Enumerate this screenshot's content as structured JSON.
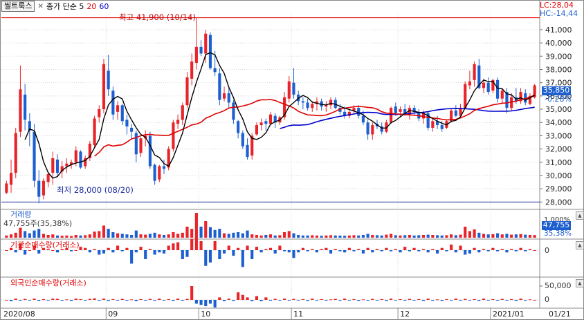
{
  "legend": {
    "prefix": "씰트룩스",
    "ma_label": "종가 단순 5",
    "ma20_label": "20",
    "ma60_label": "60"
  },
  "top_right": {
    "lc": "LC:28,04",
    "hc": "HC:-14,44"
  },
  "annotations": {
    "high": "최고 41,900 (10/14)",
    "low": "최저 28,000 (08/20)"
  },
  "current": {
    "price": "35,850",
    "change": "-0.28%"
  },
  "volume_panel": {
    "title": "거래량",
    "value_text": "47,755주(35,38%)",
    "axis_top": "1,000%",
    "current": "47,755",
    "current_pct": "35,38%"
  },
  "inst_panel": {
    "title": "기관순매수량(거래소)",
    "axis_zero": "0"
  },
  "foreign_panel": {
    "title": "외국인순매수량(거래소)",
    "axis_top": "50,000",
    "axis_zero": "0"
  },
  "colors": {
    "up": "#e8242a",
    "down": "#1e5fd0",
    "ma5": "#000000",
    "ma20": "#e00000",
    "ma60": "#0000cc"
  },
  "chart_data": {
    "type": "candlestick",
    "title": "",
    "y_ticks": [
      "41,000",
      "40,000",
      "39,000",
      "38,000",
      "37,000",
      "36,000",
      "35,000",
      "34,000",
      "33,000",
      "32,000",
      "31,000",
      "30,000",
      "29,000",
      "28,000"
    ],
    "x_ticks": [
      "2020/08",
      "09",
      "10",
      "11",
      "12",
      "2021/01",
      "01/21"
    ],
    "ylim": [
      27600,
      42300
    ],
    "grid": true,
    "high_price": 41900,
    "low_price": 28000,
    "series": [
      {
        "name": "price",
        "ohlc": [
          [
            28700,
            29600,
            28600,
            29400
          ],
          [
            29300,
            31200,
            28700,
            30200
          ],
          [
            30200,
            33600,
            29800,
            33200
          ],
          [
            33300,
            38300,
            32900,
            36500
          ],
          [
            36100,
            36900,
            33400,
            34200
          ],
          [
            34100,
            34700,
            32200,
            33400
          ],
          [
            33300,
            33900,
            29100,
            29600
          ],
          [
            29600,
            30400,
            27900,
            28400
          ],
          [
            28500,
            29800,
            28200,
            29600
          ],
          [
            29500,
            30300,
            29100,
            30100
          ],
          [
            30200,
            31800,
            29300,
            31300
          ],
          [
            31200,
            31600,
            29900,
            30200
          ],
          [
            30300,
            31100,
            29800,
            30700
          ],
          [
            30700,
            31300,
            30200,
            30900
          ],
          [
            30800,
            31200,
            30500,
            31000
          ],
          [
            31000,
            32200,
            30700,
            31900
          ],
          [
            31800,
            31900,
            30500,
            30600
          ],
          [
            30700,
            31500,
            30500,
            31300
          ],
          [
            31300,
            32600,
            31100,
            32400
          ],
          [
            32300,
            34500,
            32100,
            34300
          ],
          [
            34400,
            35300,
            34000,
            35000
          ],
          [
            35000,
            38800,
            34700,
            38400
          ],
          [
            37900,
            39100,
            36000,
            36500
          ],
          [
            36400,
            36700,
            34200,
            34600
          ],
          [
            34800,
            35600,
            34200,
            35300
          ],
          [
            35300,
            35400,
            33800,
            34100
          ],
          [
            34200,
            34600,
            33100,
            33700
          ],
          [
            33600,
            33900,
            32800,
            33300
          ],
          [
            33200,
            33400,
            31000,
            31600
          ],
          [
            31700,
            32900,
            31400,
            32800
          ],
          [
            32800,
            33400,
            32200,
            33000
          ],
          [
            33000,
            33300,
            30500,
            30700
          ],
          [
            30800,
            30900,
            29300,
            29600
          ],
          [
            29700,
            30800,
            29500,
            30700
          ],
          [
            30700,
            31200,
            30100,
            30500
          ],
          [
            30600,
            32200,
            30400,
            32000
          ],
          [
            32000,
            34200,
            31800,
            34000
          ],
          [
            33900,
            34600,
            33500,
            34200
          ],
          [
            34200,
            35500,
            33800,
            35300
          ],
          [
            35300,
            37800,
            35100,
            37400
          ],
          [
            37300,
            39200,
            36800,
            38600
          ],
          [
            38500,
            41900,
            38000,
            39700
          ],
          [
            39700,
            40200,
            39000,
            39200
          ],
          [
            39200,
            41000,
            38500,
            40700
          ],
          [
            40600,
            40800,
            38000,
            38100
          ],
          [
            38100,
            39400,
            37500,
            37800
          ],
          [
            37700,
            38100,
            35300,
            35700
          ],
          [
            35800,
            36700,
            35600,
            36200
          ],
          [
            36200,
            36600,
            35100,
            35500
          ],
          [
            35500,
            35700,
            33900,
            34200
          ],
          [
            34100,
            34200,
            32800,
            33200
          ],
          [
            33200,
            33400,
            32000,
            32200
          ],
          [
            32300,
            32800,
            31200,
            31400
          ],
          [
            31500,
            33200,
            31200,
            33000
          ],
          [
            33100,
            34000,
            33000,
            33800
          ],
          [
            33800,
            34300,
            33400,
            34000
          ],
          [
            34100,
            34300,
            33400,
            33900
          ],
          [
            33900,
            34800,
            33800,
            34600
          ],
          [
            34500,
            34700,
            33600,
            34000
          ],
          [
            34000,
            34500,
            33800,
            34400
          ],
          [
            34400,
            36300,
            34200,
            35900
          ],
          [
            35800,
            37500,
            35500,
            37100
          ],
          [
            37000,
            38100,
            35800,
            36100
          ],
          [
            36100,
            36400,
            35300,
            35600
          ],
          [
            35600,
            35900,
            35000,
            35500
          ],
          [
            35500,
            35800,
            34900,
            35100
          ],
          [
            35100,
            35600,
            34800,
            35400
          ],
          [
            35400,
            35900,
            34900,
            35600
          ],
          [
            35600,
            35800,
            34900,
            35200
          ],
          [
            35200,
            35600,
            34800,
            35300
          ],
          [
            35300,
            35900,
            35000,
            35700
          ],
          [
            35700,
            35900,
            35000,
            35100
          ],
          [
            35100,
            35400,
            34600,
            34800
          ],
          [
            34800,
            35200,
            34300,
            34500
          ],
          [
            34500,
            35000,
            34300,
            34800
          ],
          [
            34900,
            35300,
            34600,
            35100
          ],
          [
            35100,
            35300,
            34300,
            34500
          ],
          [
            34500,
            34900,
            33800,
            34000
          ],
          [
            34000,
            34200,
            32700,
            33100
          ],
          [
            33100,
            34000,
            32700,
            33800
          ],
          [
            33900,
            34200,
            33500,
            33700
          ],
          [
            33700,
            34000,
            33100,
            33300
          ],
          [
            33300,
            34200,
            33200,
            34000
          ],
          [
            34000,
            35200,
            33900,
            35100
          ],
          [
            35200,
            35500,
            34500,
            34700
          ],
          [
            34800,
            35200,
            34400,
            35000
          ],
          [
            35000,
            35400,
            34500,
            34600
          ],
          [
            34600,
            35300,
            34200,
            35100
          ],
          [
            35100,
            35300,
            34600,
            34800
          ],
          [
            34800,
            35000,
            34100,
            34300
          ],
          [
            34300,
            34900,
            33900,
            34700
          ],
          [
            34700,
            34800,
            33400,
            33600
          ],
          [
            33600,
            34300,
            33300,
            34100
          ],
          [
            34100,
            34500,
            33500,
            33800
          ],
          [
            33800,
            34100,
            33300,
            33500
          ],
          [
            33600,
            34200,
            33500,
            34100
          ],
          [
            34100,
            35000,
            34000,
            34900
          ],
          [
            34900,
            35300,
            34400,
            34500
          ],
          [
            34500,
            35400,
            34400,
            35100
          ],
          [
            35100,
            37100,
            35000,
            36900
          ],
          [
            36800,
            37900,
            36500,
            37100
          ],
          [
            37200,
            38600,
            36700,
            38400
          ],
          [
            38300,
            38800,
            36500,
            36600
          ],
          [
            36600,
            37300,
            36200,
            37000
          ],
          [
            37000,
            37400,
            36100,
            36300
          ],
          [
            36400,
            37300,
            36200,
            37200
          ],
          [
            37200,
            37400,
            35500,
            35800
          ],
          [
            35800,
            36600,
            35400,
            36400
          ],
          [
            36300,
            36600,
            34700,
            35100
          ],
          [
            35100,
            36200,
            34900,
            35900
          ],
          [
            35900,
            36600,
            35400,
            35600
          ],
          [
            35600,
            36600,
            35400,
            36300
          ],
          [
            36200,
            36500,
            35300,
            35500
          ],
          [
            35400,
            36200,
            35300,
            36000
          ],
          [
            35900,
            36900,
            35800,
            36800
          ]
        ]
      },
      {
        "name": "volume",
        "values": [
          40,
          60,
          90,
          180,
          120,
          80,
          130,
          160,
          70,
          50,
          60,
          40,
          35,
          40,
          30,
          50,
          40,
          45,
          60,
          110,
          120,
          220,
          160,
          100,
          80,
          70,
          60,
          50,
          130,
          60,
          55,
          70,
          90,
          60,
          50,
          60,
          100,
          70,
          90,
          200,
          160,
          450,
          200,
          300,
          190,
          140,
          160,
          80,
          70,
          90,
          100,
          80,
          130,
          60,
          50,
          40,
          50,
          60,
          40,
          45,
          100,
          120,
          80,
          50,
          40,
          40,
          45,
          40,
          35,
          40,
          45,
          40,
          38,
          35,
          40,
          45,
          40,
          50,
          70,
          50,
          45,
          40,
          55,
          70,
          45,
          40,
          45,
          50,
          40,
          45,
          50,
          55,
          50,
          45,
          40,
          45,
          60,
          45,
          55,
          200,
          120,
          150,
          90,
          70,
          60,
          65,
          80,
          60,
          70,
          55,
          60,
          65,
          55,
          50,
          48
        ]
      },
      {
        "name": "institution_net",
        "values": [
          0,
          10,
          -10,
          30,
          -20,
          0,
          20,
          -15,
          10,
          5,
          0,
          -10,
          5,
          10,
          -5,
          0,
          15,
          10,
          -10,
          5,
          -20,
          -15,
          10,
          -10,
          20,
          -5,
          10,
          -60,
          -10,
          15,
          -40,
          5,
          -20,
          -10,
          -15,
          20,
          30,
          35,
          -40,
          -30,
          50,
          60,
          40,
          -70,
          -55,
          40,
          -40,
          -15,
          20,
          -25,
          10,
          -75,
          20,
          -40,
          15,
          -10,
          5,
          10,
          -15,
          20,
          -5,
          -10,
          -35,
          -10,
          10,
          -5,
          5,
          -10,
          5,
          10,
          -15,
          5,
          -5,
          -10,
          10,
          -5,
          5,
          -15,
          10,
          -10,
          5,
          -5,
          10,
          -5,
          5,
          -10,
          15,
          -5,
          10,
          -5,
          5,
          -10,
          5,
          -15,
          10,
          -5,
          25,
          -10,
          20,
          -20,
          -15,
          10,
          -10,
          5,
          -5,
          10,
          -5,
          5,
          -10,
          5,
          -5,
          10,
          -5,
          5,
          0
        ]
      },
      {
        "name": "foreign_net",
        "values": [
          0,
          -5,
          5,
          -3,
          4,
          -2,
          5,
          -4,
          3,
          -2,
          5,
          4,
          -3,
          2,
          -4,
          5,
          3,
          -2,
          4,
          6,
          -3,
          5,
          -4,
          3,
          -2,
          4,
          -3,
          2,
          -5,
          3,
          -2,
          4,
          -3,
          5,
          -2,
          3,
          -4,
          5,
          -3,
          4,
          55,
          -15,
          -20,
          -25,
          -15,
          -30,
          10,
          -5,
          5,
          -4,
          30,
          20,
          10,
          -5,
          15,
          -5,
          10,
          -3,
          4,
          -2,
          5,
          -3,
          4,
          -2,
          3,
          -4,
          5,
          -2,
          3,
          -3,
          2,
          4,
          -3,
          5,
          -2,
          3,
          -4,
          2,
          -3,
          4,
          -2,
          3,
          -4,
          5,
          -2,
          3,
          -3,
          4,
          -2,
          3,
          -4,
          5,
          -3,
          2,
          -4,
          3,
          -2,
          5,
          -3,
          4,
          -2,
          3,
          -4,
          5,
          -2,
          3,
          -3,
          4,
          -2,
          3,
          -4,
          5,
          -3,
          2,
          0
        ]
      }
    ]
  }
}
